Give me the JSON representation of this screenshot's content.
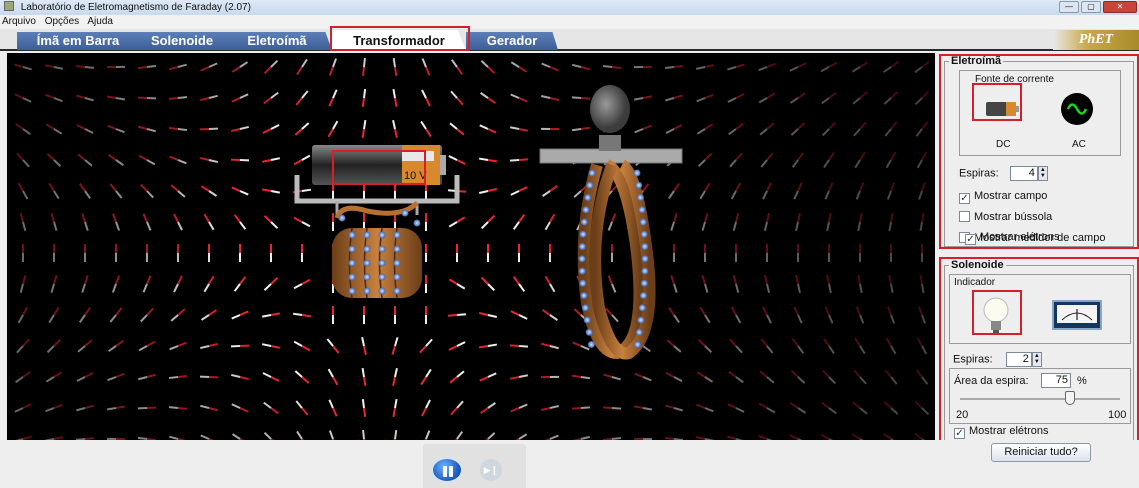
{
  "window": {
    "title": "Laboratório de Eletromagnetismo de Faraday (2.07)"
  },
  "menu": [
    "Arquivo",
    "Opções",
    "Ajuda"
  ],
  "tabs": [
    {
      "label": "Ímã em Barra"
    },
    {
      "label": "Solenoide"
    },
    {
      "label": "Eletroímã"
    },
    {
      "label": "Transformador",
      "active": true
    },
    {
      "label": "Gerador"
    }
  ],
  "logo": "PhET",
  "canvas": {
    "battery_voltage": "10 V"
  },
  "electromagnet": {
    "title": "Eletroímã",
    "source_title": "Fonte de corrente",
    "dc_label": "DC",
    "ac_label": "AC",
    "selected_source": "DC",
    "loops_label": "Espiras:",
    "loops_value": "4",
    "show_field": {
      "label": "Mostrar campo",
      "checked": true
    },
    "show_compass": {
      "label": "Mostrar bússola",
      "checked": false
    },
    "show_meter": {
      "label": "Mostrar medidor de campo",
      "checked": false
    },
    "show_electrons": {
      "label": "Mostrar elétrons",
      "checked": true
    }
  },
  "solenoid": {
    "title": "Solenoide",
    "indicator_title": "Indicador",
    "selected_indicator": "bulb",
    "loops_label": "Espiras:",
    "loops_value": "2",
    "area_label": "Área da espira:",
    "area_value": "75",
    "area_unit": "%",
    "slider_min": "20",
    "slider_max": "100",
    "slider_fraction": 0.69,
    "show_electrons": {
      "label": "Mostrar elétrons",
      "checked": true
    }
  },
  "controls": {
    "reset_label": "Reiniciar tudo?"
  },
  "colors": {
    "accent_red": "#d81e2a",
    "tab_blue": "#4a6ca8"
  }
}
